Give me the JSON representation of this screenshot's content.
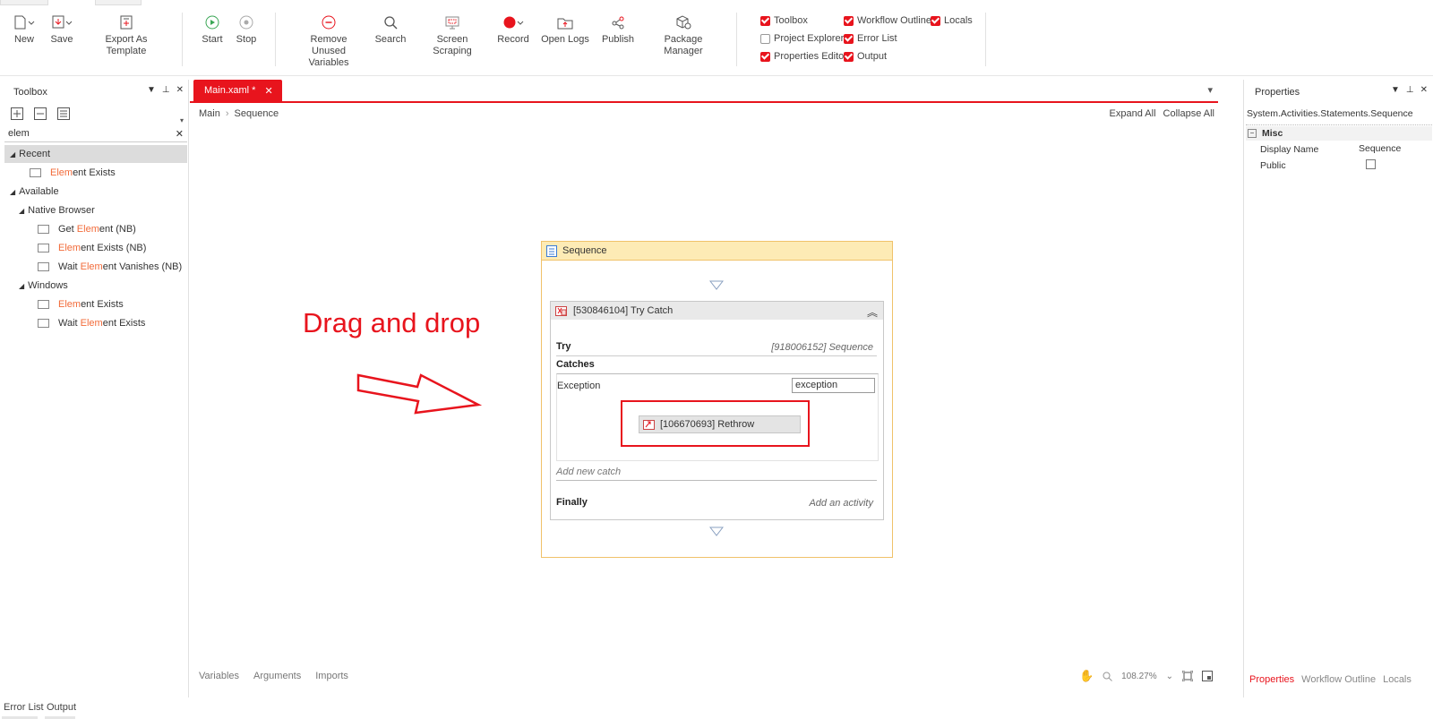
{
  "ribbon": {
    "new_label": "New",
    "save_label": "Save",
    "export_label": "Export As Template",
    "start_label": "Start",
    "stop_label": "Stop",
    "remove_label": "Remove Unused\nVariables",
    "search_label": "Search",
    "scraping_label": "Screen Scraping",
    "record_label": "Record",
    "logs_label": "Open Logs",
    "publish_label": "Publish",
    "package_label": "Package Manager",
    "checkboxes": {
      "toolbox": "Toolbox",
      "workflow_outline": "Workflow Outline",
      "locals": "Locals",
      "project_explorer": "Project Explorer",
      "error_list": "Error List",
      "properties_editor": "Properties Editor",
      "output": "Output"
    }
  },
  "toolbox": {
    "title": "Toolbox",
    "search_value": "elem",
    "recent": "Recent",
    "recent_item_hl": "Elem",
    "recent_item_rest": "ent Exists",
    "available": "Available",
    "native_browser": "Native Browser",
    "nb_items": [
      {
        "pre": "Get ",
        "hl": "Elem",
        "post": "ent (NB)"
      },
      {
        "pre": "",
        "hl": "Elem",
        "post": "ent Exists (NB)"
      },
      {
        "pre": "Wait ",
        "hl": "Elem",
        "post": "ent Vanishes (NB)"
      }
    ],
    "windows": "Windows",
    "win_items": [
      {
        "pre": "",
        "hl": "Elem",
        "post": "ent Exists"
      },
      {
        "pre": "Wait ",
        "hl": "Elem",
        "post": "ent Exists"
      }
    ]
  },
  "designer": {
    "tab_label": "Main.xaml *",
    "breadcrumb_root": "Main",
    "breadcrumb_current": "Sequence",
    "expand_all": "Expand All",
    "collapse_all": "Collapse All",
    "annotation": "Drag and drop",
    "sequence_title": "Sequence",
    "trycatch_title": "[530846104] Try Catch",
    "try_label": "Try",
    "try_value": "[918006152] Sequence",
    "catches_label": "Catches",
    "exception_label": "Exception",
    "exception_value": "exception",
    "rethrow_label": "[106670693] Rethrow",
    "add_catch": "Add new catch",
    "finally_label": "Finally",
    "add_activity": "Add an activity",
    "bottom_tabs": [
      "Variables",
      "Arguments",
      "Imports"
    ],
    "zoom": "108.27%"
  },
  "properties": {
    "title": "Properties",
    "type_name": "System.Activities.Statements.Sequence",
    "misc": "Misc",
    "display_name_label": "Display Name",
    "display_name_value": "Sequence",
    "public_label": "Public",
    "bottom_tabs": [
      "Properties",
      "Workflow Outline",
      "Locals"
    ]
  },
  "status": {
    "error_list": "Error List",
    "output": "Output"
  },
  "colors": {
    "accent": "#e8141d",
    "highlight": "#f26b3a",
    "sequence_header": "#fdebb5"
  }
}
